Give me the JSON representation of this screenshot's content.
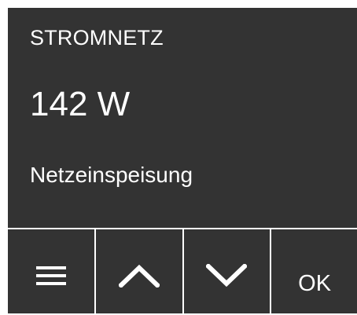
{
  "display": {
    "title": "STROMNETZ",
    "value": "142 W",
    "subtitle": "Netzeinspeisung"
  },
  "buttons": {
    "menu_icon": "menu-icon",
    "up_icon": "chevron-up-icon",
    "down_icon": "chevron-down-icon",
    "ok_label": "OK"
  },
  "colors": {
    "background": "#333333",
    "foreground": "#ffffff"
  }
}
